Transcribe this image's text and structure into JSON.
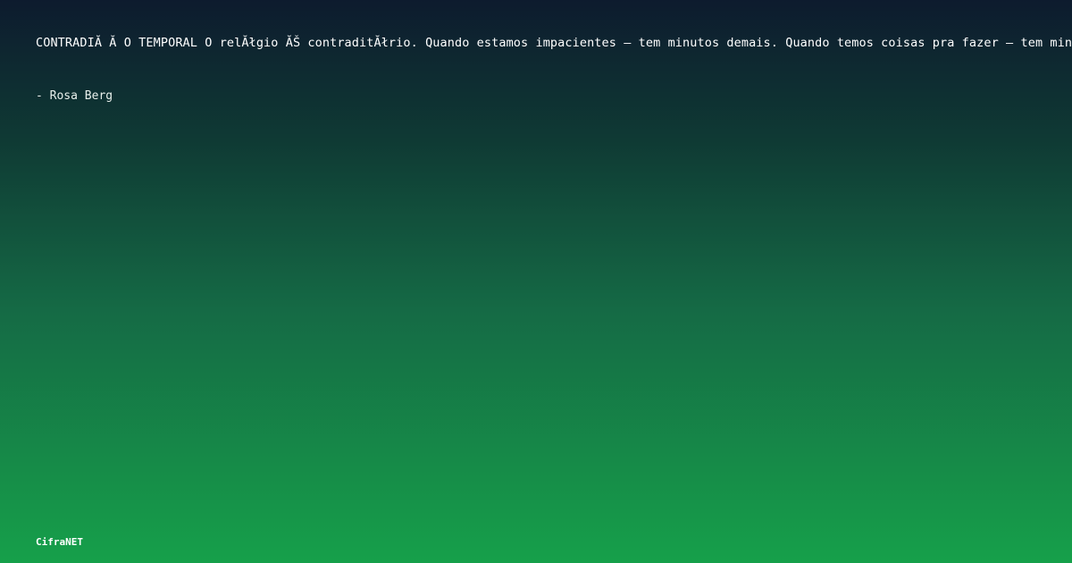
{
  "card": {
    "quote": "CONTRADIĂ Ă O TEMPORAL O relĂłgio ĂŠ contraditĂłrio. Quando estamos impacientes – tem minutos demais. Quando temos coisas pra fazer – tem minutos de menos.",
    "author": "- Rosa Berg",
    "brand": "CifraNET"
  }
}
